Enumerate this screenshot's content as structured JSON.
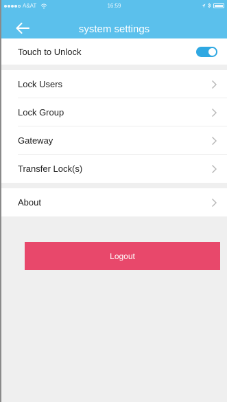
{
  "status_bar": {
    "carrier": "A&AT",
    "time": "16:59",
    "right_icons": [
      "location-icon",
      "bluetooth-icon",
      "battery-icon"
    ]
  },
  "header": {
    "title": "system settings",
    "back_icon": "arrow-left-icon"
  },
  "settings": {
    "touch_to_unlock": {
      "label": "Touch to Unlock",
      "enabled": true
    },
    "items": [
      {
        "label": "Lock Users"
      },
      {
        "label": "Lock Group"
      },
      {
        "label": "Gateway"
      },
      {
        "label": "Transfer Lock(s)"
      }
    ],
    "about": {
      "label": "About"
    }
  },
  "logout": {
    "label": "Logout"
  },
  "colors": {
    "header": "#5bc0ec",
    "toggle": "#2fa8e2",
    "logout": "#e8486b",
    "background": "#efefef"
  }
}
